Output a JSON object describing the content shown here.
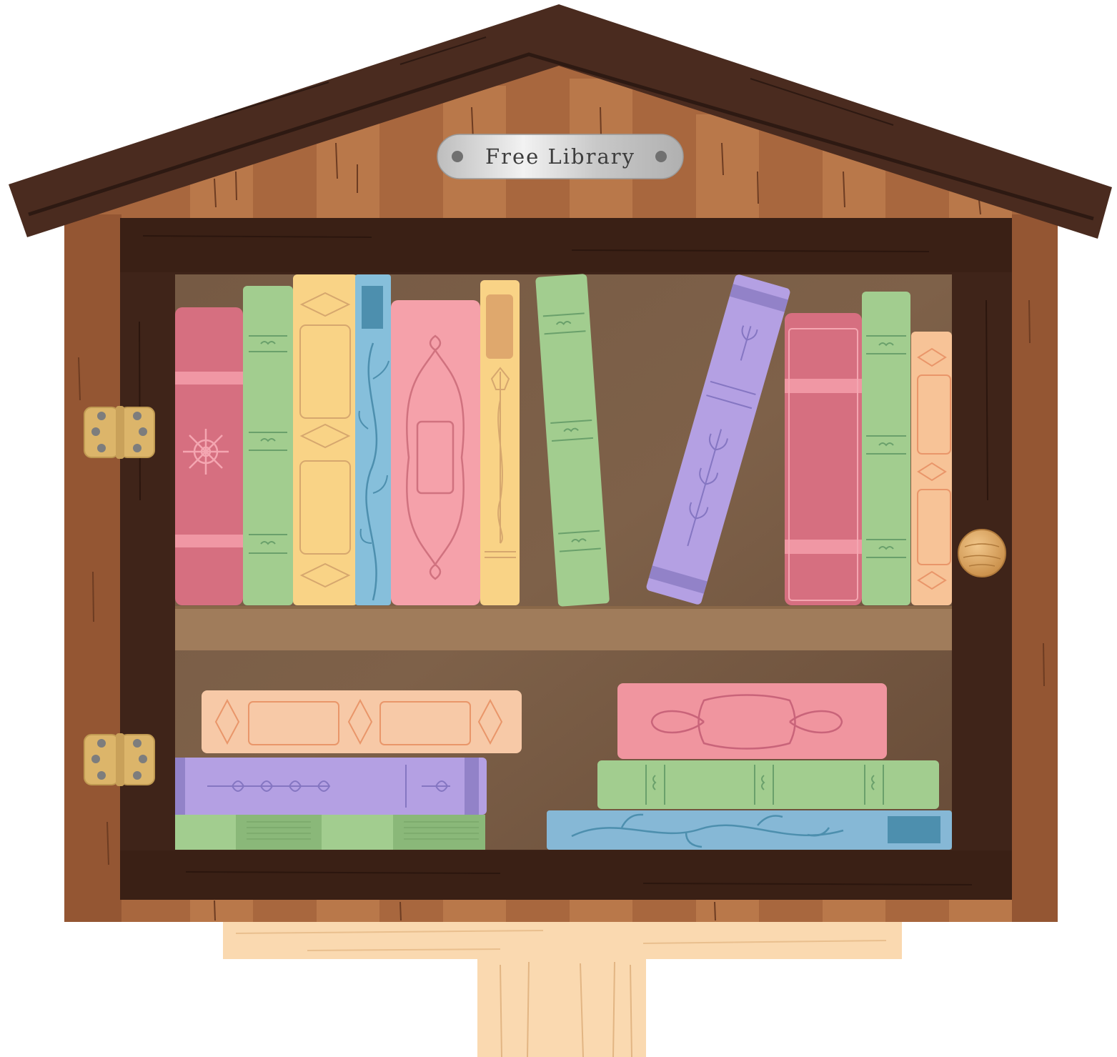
{
  "sign": {
    "label": "Free Library"
  },
  "colors": {
    "background": "#ffffff",
    "roof": "#4a2b1f",
    "wood_wall": "#a8673e",
    "door_frame": "#3f2419",
    "shelf_interior": "#70553f",
    "shelf_board": "#a07c5b",
    "post": "#fad9b0",
    "hinge": "#dcb56a",
    "knob": "#d49b53",
    "plaque": "#c9c9c9"
  },
  "books": {
    "top_shelf": [
      {
        "color": "#d66f80",
        "ornament": "flower"
      },
      {
        "color": "#a2cd8f",
        "ornament": "leaf-bands"
      },
      {
        "color": "#f9d386",
        "ornament": "diamond-panels"
      },
      {
        "color": "#86bfdb",
        "ornament": "vine"
      },
      {
        "color": "#f5a1aa",
        "ornament": "loop-frame"
      },
      {
        "color": "#f9d386",
        "ornament": "thistle"
      },
      {
        "color": "#a2cd8f",
        "ornament": "leaf-bands",
        "tilted": true
      },
      {
        "color": "#b4a0e3",
        "ornament": "sprig",
        "tilted": true
      },
      {
        "color": "#d66f80",
        "ornament": "bands"
      },
      {
        "color": "#a2cd8f",
        "ornament": "leaf-bands"
      },
      {
        "color": "#f7c397",
        "ornament": "diamond-panels"
      }
    ],
    "bottom_left_stack": [
      {
        "color": "#f7c9a7",
        "ornament": "diamond-panels"
      },
      {
        "color": "#b4a0e3",
        "ornament": "sprig"
      },
      {
        "color": "#a2cd8f",
        "ornament": "ribbed"
      }
    ],
    "bottom_right_stack": [
      {
        "color": "#f0959f",
        "ornament": "loop-frame"
      },
      {
        "color": "#a2cd8f",
        "ornament": "leaf-bands"
      },
      {
        "color": "#86b8d6",
        "ornament": "vine"
      }
    ]
  }
}
